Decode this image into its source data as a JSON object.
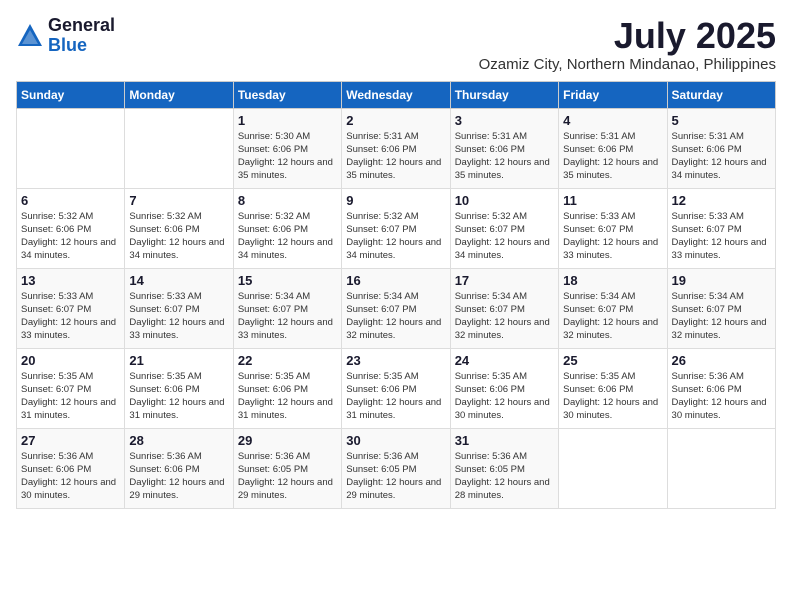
{
  "header": {
    "logo_general": "General",
    "logo_blue": "Blue",
    "month": "July 2025",
    "location": "Ozamiz City, Northern Mindanao, Philippines"
  },
  "weekdays": [
    "Sunday",
    "Monday",
    "Tuesday",
    "Wednesday",
    "Thursday",
    "Friday",
    "Saturday"
  ],
  "weeks": [
    [
      {
        "day": "",
        "info": ""
      },
      {
        "day": "",
        "info": ""
      },
      {
        "day": "1",
        "info": "Sunrise: 5:30 AM\nSunset: 6:06 PM\nDaylight: 12 hours and 35 minutes."
      },
      {
        "day": "2",
        "info": "Sunrise: 5:31 AM\nSunset: 6:06 PM\nDaylight: 12 hours and 35 minutes."
      },
      {
        "day": "3",
        "info": "Sunrise: 5:31 AM\nSunset: 6:06 PM\nDaylight: 12 hours and 35 minutes."
      },
      {
        "day": "4",
        "info": "Sunrise: 5:31 AM\nSunset: 6:06 PM\nDaylight: 12 hours and 35 minutes."
      },
      {
        "day": "5",
        "info": "Sunrise: 5:31 AM\nSunset: 6:06 PM\nDaylight: 12 hours and 34 minutes."
      }
    ],
    [
      {
        "day": "6",
        "info": "Sunrise: 5:32 AM\nSunset: 6:06 PM\nDaylight: 12 hours and 34 minutes."
      },
      {
        "day": "7",
        "info": "Sunrise: 5:32 AM\nSunset: 6:06 PM\nDaylight: 12 hours and 34 minutes."
      },
      {
        "day": "8",
        "info": "Sunrise: 5:32 AM\nSunset: 6:06 PM\nDaylight: 12 hours and 34 minutes."
      },
      {
        "day": "9",
        "info": "Sunrise: 5:32 AM\nSunset: 6:07 PM\nDaylight: 12 hours and 34 minutes."
      },
      {
        "day": "10",
        "info": "Sunrise: 5:32 AM\nSunset: 6:07 PM\nDaylight: 12 hours and 34 minutes."
      },
      {
        "day": "11",
        "info": "Sunrise: 5:33 AM\nSunset: 6:07 PM\nDaylight: 12 hours and 33 minutes."
      },
      {
        "day": "12",
        "info": "Sunrise: 5:33 AM\nSunset: 6:07 PM\nDaylight: 12 hours and 33 minutes."
      }
    ],
    [
      {
        "day": "13",
        "info": "Sunrise: 5:33 AM\nSunset: 6:07 PM\nDaylight: 12 hours and 33 minutes."
      },
      {
        "day": "14",
        "info": "Sunrise: 5:33 AM\nSunset: 6:07 PM\nDaylight: 12 hours and 33 minutes."
      },
      {
        "day": "15",
        "info": "Sunrise: 5:34 AM\nSunset: 6:07 PM\nDaylight: 12 hours and 33 minutes."
      },
      {
        "day": "16",
        "info": "Sunrise: 5:34 AM\nSunset: 6:07 PM\nDaylight: 12 hours and 32 minutes."
      },
      {
        "day": "17",
        "info": "Sunrise: 5:34 AM\nSunset: 6:07 PM\nDaylight: 12 hours and 32 minutes."
      },
      {
        "day": "18",
        "info": "Sunrise: 5:34 AM\nSunset: 6:07 PM\nDaylight: 12 hours and 32 minutes."
      },
      {
        "day": "19",
        "info": "Sunrise: 5:34 AM\nSunset: 6:07 PM\nDaylight: 12 hours and 32 minutes."
      }
    ],
    [
      {
        "day": "20",
        "info": "Sunrise: 5:35 AM\nSunset: 6:07 PM\nDaylight: 12 hours and 31 minutes."
      },
      {
        "day": "21",
        "info": "Sunrise: 5:35 AM\nSunset: 6:06 PM\nDaylight: 12 hours and 31 minutes."
      },
      {
        "day": "22",
        "info": "Sunrise: 5:35 AM\nSunset: 6:06 PM\nDaylight: 12 hours and 31 minutes."
      },
      {
        "day": "23",
        "info": "Sunrise: 5:35 AM\nSunset: 6:06 PM\nDaylight: 12 hours and 31 minutes."
      },
      {
        "day": "24",
        "info": "Sunrise: 5:35 AM\nSunset: 6:06 PM\nDaylight: 12 hours and 30 minutes."
      },
      {
        "day": "25",
        "info": "Sunrise: 5:35 AM\nSunset: 6:06 PM\nDaylight: 12 hours and 30 minutes."
      },
      {
        "day": "26",
        "info": "Sunrise: 5:36 AM\nSunset: 6:06 PM\nDaylight: 12 hours and 30 minutes."
      }
    ],
    [
      {
        "day": "27",
        "info": "Sunrise: 5:36 AM\nSunset: 6:06 PM\nDaylight: 12 hours and 30 minutes."
      },
      {
        "day": "28",
        "info": "Sunrise: 5:36 AM\nSunset: 6:06 PM\nDaylight: 12 hours and 29 minutes."
      },
      {
        "day": "29",
        "info": "Sunrise: 5:36 AM\nSunset: 6:05 PM\nDaylight: 12 hours and 29 minutes."
      },
      {
        "day": "30",
        "info": "Sunrise: 5:36 AM\nSunset: 6:05 PM\nDaylight: 12 hours and 29 minutes."
      },
      {
        "day": "31",
        "info": "Sunrise: 5:36 AM\nSunset: 6:05 PM\nDaylight: 12 hours and 28 minutes."
      },
      {
        "day": "",
        "info": ""
      },
      {
        "day": "",
        "info": ""
      }
    ]
  ]
}
